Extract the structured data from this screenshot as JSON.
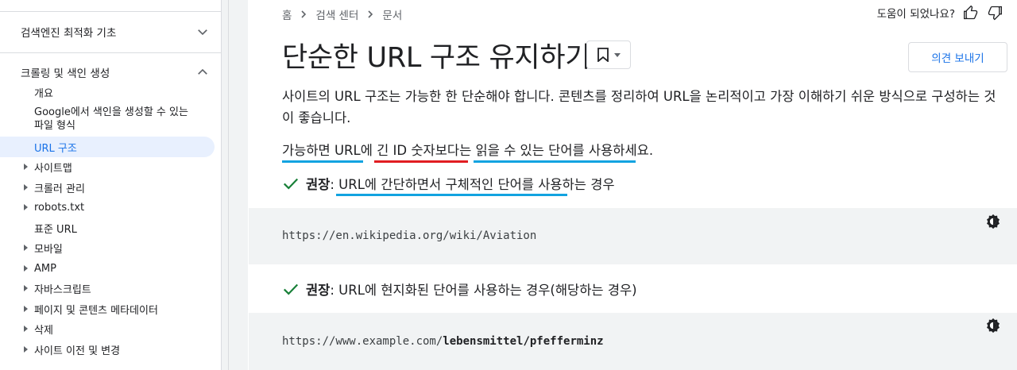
{
  "sidebar": {
    "sections": [
      {
        "label": "검색엔진 최적화 기초",
        "expanded": false
      },
      {
        "label": "크롤링 및 색인 생성",
        "expanded": true
      }
    ],
    "items": [
      {
        "label": "개요",
        "has_arrow": false
      },
      {
        "label": "Google에서 색인을 생성할 수 있는 파일 형식",
        "has_arrow": false
      },
      {
        "label": "URL 구조",
        "has_arrow": false,
        "active": true
      },
      {
        "label": "사이트맵",
        "has_arrow": true
      },
      {
        "label": "크롤러 관리",
        "has_arrow": true
      },
      {
        "label": "robots.txt",
        "has_arrow": true
      },
      {
        "label": "표준 URL",
        "has_arrow": false
      },
      {
        "label": "모바일",
        "has_arrow": true
      },
      {
        "label": "AMP",
        "has_arrow": true
      },
      {
        "label": "자바스크립트",
        "has_arrow": true
      },
      {
        "label": "페이지 및 콘텐츠 메타데이터",
        "has_arrow": true
      },
      {
        "label": "삭제",
        "has_arrow": true
      },
      {
        "label": "사이트 이전 및 변경",
        "has_arrow": true
      }
    ]
  },
  "breadcrumb": [
    "홈",
    "검색 센터",
    "문서"
  ],
  "helpful": {
    "label": "도움이 되었나요?"
  },
  "page": {
    "title": "단순한 URL 구조 유지하기",
    "feedback_button": "의견 보내기",
    "intro": "사이트의 URL 구조는 가능한 한 단순해야 합니다. 콘텐츠를 정리하여 URL을 논리적이고 가장 이해하기 쉬운 방식으로 구성하는 것이 좋습니다.",
    "line2": "가능하면 URL에 긴 ID 숫자보다는 읽을 수 있는 단어를 사용하세요.",
    "recommendations": [
      {
        "label": "권장",
        "text": ": URL에 간단하면서 구체적인 단어를 사용하는 경우",
        "code_plain": "https://en.wikipedia.org/wiki/Aviation",
        "code_bold": ""
      },
      {
        "label": "권장",
        "text": ": URL에 현지화된 단어를 사용하는 경우(해당하는 경우)",
        "code_plain": "https://www.example.com/",
        "code_bold": "lebensmittel/pfefferminz"
      }
    ]
  },
  "colors": {
    "accent": "#1a73e8",
    "active_bg": "#e8f0fe",
    "check_green": "#188038",
    "underline_blue": "#12a3e0",
    "underline_red": "#e11d21",
    "code_bg": "#f1f3f4"
  },
  "icons": [
    "chevron-down-icon",
    "chevron-up-icon",
    "caret-right-icon",
    "chevron-right-icon",
    "thumb-up-icon",
    "thumb-down-icon",
    "bookmark-icon",
    "dropdown-arrow-icon",
    "check-icon",
    "theme-toggle-icon"
  ]
}
